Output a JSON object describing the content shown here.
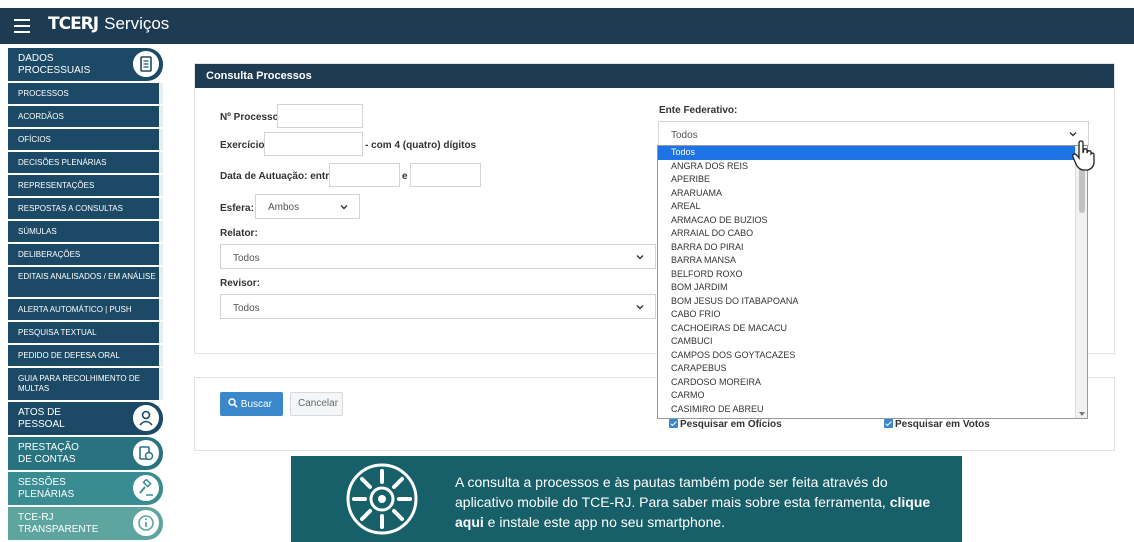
{
  "topbar": {
    "logo_mark": "TCERJ",
    "title": "Serviços"
  },
  "sidebar": {
    "sections": [
      {
        "label": "DADOS PROCESSUAIS",
        "icon": "document-icon"
      },
      {
        "label": "ATOS DE PESSOAL",
        "icon": "person-icon"
      },
      {
        "label": "PRESTAÇÃO DE CONTAS",
        "icon": "money-icon"
      },
      {
        "label": "SESSÕES PLENÁRIAS",
        "icon": "gavel-icon"
      },
      {
        "label": "TCE-RJ TRANSPARENTE",
        "icon": "info-icon"
      }
    ],
    "items": [
      "PROCESSOS",
      "ACORDÃOS",
      "OFÍCIOS",
      "DECISÕES PLENÁRIAS",
      "REPRESENTAÇÕES",
      "RESPOSTAS A CONSULTAS",
      "SÚMULAS",
      "DELIBERAÇÕES",
      "EDITAIS ANALISADOS / EM ANÁLISE",
      "ALERTA AUTOMÁTICO | PUSH",
      "PESQUISA TEXTUAL",
      "PEDIDO DE DEFESA ORAL",
      "GUIA PARA RECOLHIMENTO DE MULTAS"
    ]
  },
  "form": {
    "title": "Consulta Processos",
    "processo_label": "Nº Processo:",
    "exercicio_label": "Exercício:",
    "exercicio_hint": "- com 4 (quatro) dígitos",
    "data_label": "Data de Autuação: entre",
    "data_e": "e",
    "esfera_label": "Esfera:",
    "esfera_value": "Ambos",
    "relator_label": "Relator:",
    "relator_value": "Todos",
    "revisor_label": "Revisor:",
    "revisor_value": "Todos",
    "ente_label": "Ente Federativo:",
    "ente_value": "Todos"
  },
  "ente_options": [
    "Todos",
    "ANGRA DOS REIS",
    "APERIBE",
    "ARARUAMA",
    "AREAL",
    "ARMACAO DE BUZIOS",
    "ARRAIAL DO CABO",
    "BARRA DO PIRAI",
    "BARRA MANSA",
    "BELFORD ROXO",
    "BOM JARDIM",
    "BOM JESUS DO ITABAPOANA",
    "CABO FRIO",
    "CACHOEIRAS DE MACACU",
    "CAMBUCI",
    "CAMPOS DOS GOYTACAZES",
    "CARAPEBUS",
    "CARDOSO MOREIRA",
    "CARMO",
    "CASIMIRO DE ABREU"
  ],
  "actions": {
    "buscar_label": "Buscar",
    "cancelar_label": "Cancelar",
    "check_oficios": "Pesquisar em Ofícios",
    "check_votos": "Pesquisar em Votos"
  },
  "banner": {
    "text": "A consulta a processos e às pautas também pode ser feita através do aplicativo mobile do TCE-RJ. Para saber mais sobre esta ferramenta,",
    "link": "clique aqui",
    "text2": "e instale este app no seu smartphone."
  },
  "colors": {
    "header": "#1d3b52",
    "sidebar": "#1c4a66",
    "accent": "#3a87c9",
    "banner": "#17606a"
  }
}
